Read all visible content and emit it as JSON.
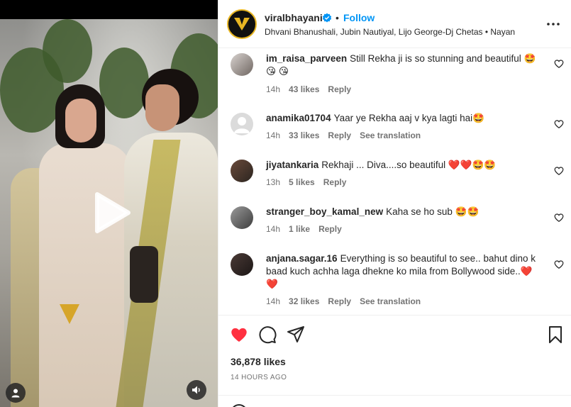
{
  "post": {
    "username": "viralbhayani",
    "follow_label": "Follow",
    "separator": "•",
    "audio_line": "Dhvani Bhanushali, Jubin Nautiyal, Lijo George-Dj Chetas • Nayan"
  },
  "comments": [
    {
      "user": "im_raisa_parveen",
      "text": "Still Rekha ji is so stunning and beautiful 🤩 😘 😘",
      "time": "14h",
      "likes": "43 likes",
      "reply": "Reply",
      "translation": ""
    },
    {
      "user": "anamika01704",
      "text": "Yaar ye Rekha aaj v kya lagti hai🤩",
      "time": "14h",
      "likes": "33 likes",
      "reply": "Reply",
      "translation": "See translation"
    },
    {
      "user": "jiyatankaria",
      "text": "Rekhaji ... Diva....so beautiful ❤️❤️🤩🤩",
      "time": "13h",
      "likes": "5 likes",
      "reply": "Reply",
      "translation": ""
    },
    {
      "user": "stranger_boy_kamal_new",
      "text": "Kaha se ho sub 🤩🤩",
      "time": "14h",
      "likes": "1 like",
      "reply": "Reply",
      "translation": ""
    },
    {
      "user": "anjana.sagar.16",
      "text": "Everything is so beautiful to see.. bahut dino k baad kuch achha laga dhekne ko mila from Bollywood side..❤️ ❤️",
      "time": "14h",
      "likes": "32 likes",
      "reply": "Reply",
      "translation": "See translation"
    }
  ],
  "footer": {
    "likes_count": "36,878 likes",
    "timestamp": "14 HOURS AGO"
  },
  "colors": {
    "accent": "#0095f6",
    "like_red": "#ff3040",
    "brand_gold": "#e8b623"
  },
  "icons": {
    "play": "play-icon",
    "user": "user-tag-icon",
    "mute": "speaker-icon",
    "verified": "verified-badge-icon",
    "more": "more-options-icon",
    "heart": "heart-icon",
    "comment": "comment-icon",
    "share": "share-icon",
    "save": "bookmark-icon"
  }
}
